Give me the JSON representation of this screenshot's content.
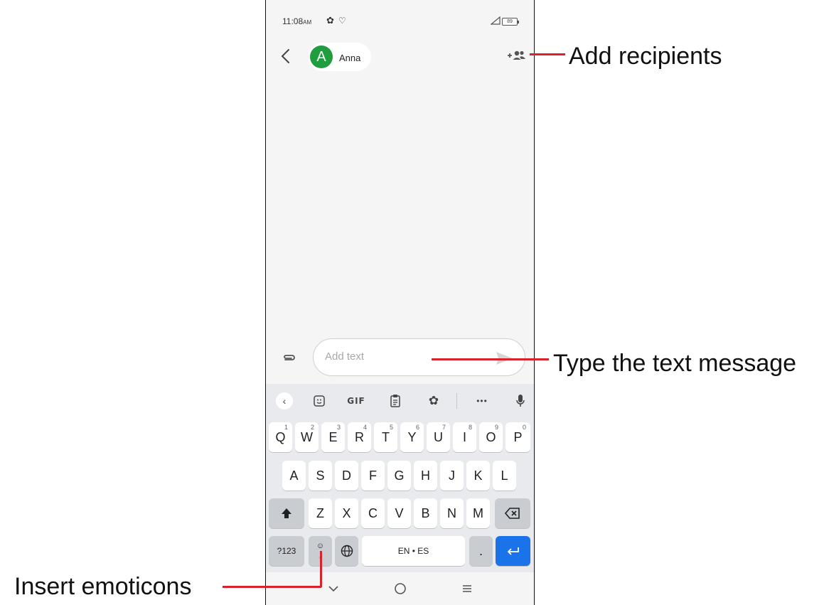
{
  "status_bar": {
    "time": "11:08",
    "ampm": "AM",
    "battery": "89"
  },
  "app_bar": {
    "contact_initial": "A",
    "contact_name": "Anna",
    "avatar_color": "#1f9d3f"
  },
  "compose": {
    "placeholder": "Add text",
    "value": ""
  },
  "keyboard": {
    "toolbar": {
      "gif_label": "GIF"
    },
    "row1": [
      {
        "label": "Q",
        "hint": "1"
      },
      {
        "label": "W",
        "hint": "2"
      },
      {
        "label": "E",
        "hint": "3"
      },
      {
        "label": "R",
        "hint": "4"
      },
      {
        "label": "T",
        "hint": "5"
      },
      {
        "label": "Y",
        "hint": "6"
      },
      {
        "label": "U",
        "hint": "7"
      },
      {
        "label": "I",
        "hint": "8"
      },
      {
        "label": "O",
        "hint": "9"
      },
      {
        "label": "P",
        "hint": "0"
      }
    ],
    "row2": [
      "A",
      "S",
      "D",
      "F",
      "G",
      "H",
      "J",
      "K",
      "L"
    ],
    "row3": [
      "Z",
      "X",
      "C",
      "V",
      "B",
      "N",
      "M"
    ],
    "row4": {
      "symbols": "?123",
      "emoji_comma": ",",
      "space": "EN • ES",
      "period": "."
    }
  },
  "annotations": {
    "add_recipients": "Add recipients",
    "type_text": "Type the text message",
    "insert_emoticons": "Insert emoticons",
    "leader_color": "#d9222e"
  }
}
